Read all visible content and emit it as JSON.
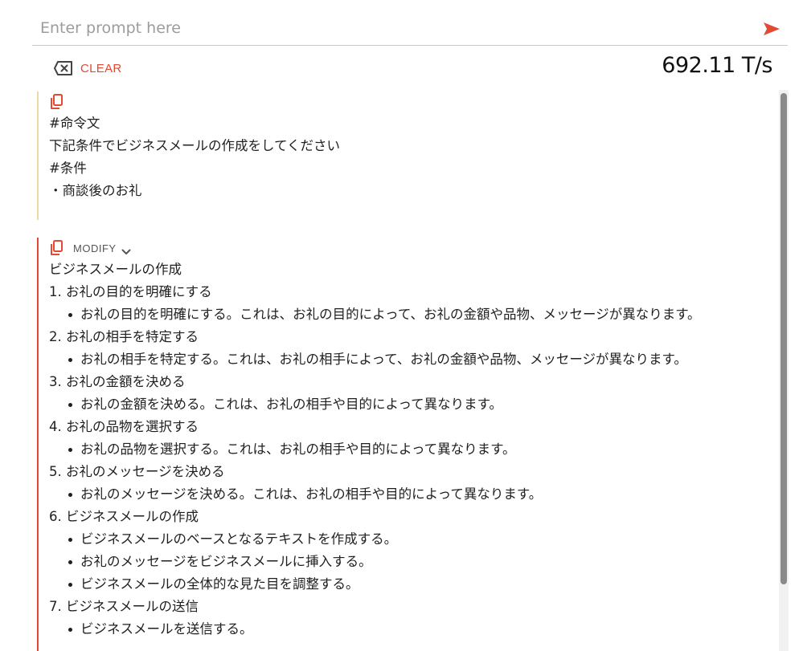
{
  "prompt": {
    "placeholder": "Enter prompt here",
    "value": "",
    "send_icon": "send-arrow-icon"
  },
  "toolbar": {
    "clear_label": "CLEAR",
    "clear_icon": "clear-box-icon",
    "speed": "692.11 T/s"
  },
  "colors": {
    "accent": "#e24a33",
    "user_border": "#e8d9a6",
    "divider": "#c8c8c8"
  },
  "user_message": {
    "icon": "copy-icon",
    "lines": [
      "#命令文",
      "下記条件でビジネスメールの作成をしてください",
      "#条件",
      "・商談後のお礼"
    ]
  },
  "assistant_message": {
    "icon": "copy-icon",
    "modify_label": "MODIFY",
    "title": "ビジネスメールの作成",
    "sections": [
      {
        "heading": "1. お礼の目的を明確にする",
        "bullets": [
          "お礼の目的を明確にする。これは、お礼の目的によって、お礼の金額や品物、メッセージが異なります。"
        ]
      },
      {
        "heading": "2. お礼の相手を特定する",
        "bullets": [
          "お礼の相手を特定する。これは、お礼の相手によって、お礼の金額や品物、メッセージが異なります。"
        ]
      },
      {
        "heading": "3. お礼の金額を決める",
        "bullets": [
          "お礼の金額を決める。これは、お礼の相手や目的によって異なります。"
        ]
      },
      {
        "heading": "4. お礼の品物を選択する",
        "bullets": [
          "お礼の品物を選択する。これは、お礼の相手や目的によって異なります。"
        ]
      },
      {
        "heading": "5. お礼のメッセージを決める",
        "bullets": [
          "お礼のメッセージを決める。これは、お礼の相手や目的によって異なります。"
        ]
      },
      {
        "heading": "6. ビジネスメールの作成",
        "bullets": [
          "ビジネスメールのベースとなるテキストを作成する。",
          "お礼のメッセージをビジネスメールに挿入する。",
          "ビジネスメールの全体的な見た目を調整する。"
        ]
      },
      {
        "heading": "7. ビジネスメールの送信",
        "bullets": [
          "ビジネスメールを送信する。"
        ]
      }
    ]
  }
}
